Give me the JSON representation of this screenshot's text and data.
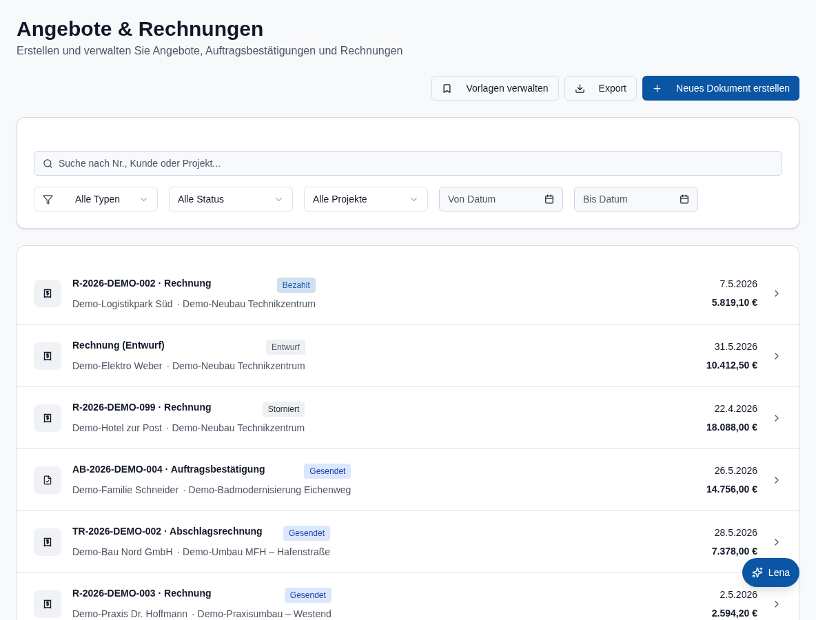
{
  "header": {
    "title": "Angebote & Rechnungen",
    "subtitle": "Erstellen und verwalten Sie Angebote, Auftragsbestätigungen und Rechnungen"
  },
  "actions": [
    {
      "kind": "templates",
      "label": "Vorlagen verwalten"
    },
    {
      "kind": "export",
      "label": "Export"
    },
    {
      "kind": "create",
      "label": "Neues Dokument erstellen"
    }
  ],
  "search": {
    "placeholder": "Suche nach Nr., Kunde oder Projekt..."
  },
  "filters": [
    {
      "kind": "select",
      "label": "Alle Typen"
    },
    {
      "kind": "select",
      "label": "Alle Status"
    },
    {
      "kind": "select",
      "label": "Alle Projekte"
    },
    {
      "kind": "date",
      "placeholder": "Von Datum"
    },
    {
      "kind": "date",
      "placeholder": "Bis Datum"
    }
  ],
  "documents": [
    {
      "kind": "invoice",
      "title": "R-2026-DEMO-002 · Rechnung",
      "color": "#cfe0f1",
      "badge": "Bezahlt",
      "customer": "Demo-Logistikpark Süd",
      "project": "· Demo-Neubau Technikzentrum",
      "date": "7.5.2026",
      "amount": "5.819,10 €"
    },
    {
      "kind": "invoice",
      "title": "Rechnung (Entwurf)",
      "color": "#eef0f3",
      "badge": "Entwurf",
      "customer": "Demo-Elektro Weber",
      "project": "· Demo-Neubau Technikzentrum",
      "date": "31.5.2026",
      "amount": "10.412,50 €"
    },
    {
      "kind": "invoice",
      "title": "R-2026-DEMO-099 · Rechnung",
      "color": "#eef0f2",
      "badge": "Storniert",
      "customer": "Demo-Hotel zur Post",
      "project": "· Demo-Neubau Technikzentrum",
      "date": "22.4.2026",
      "amount": "18.088,00 €"
    },
    {
      "kind": "confirmation",
      "title": "AB-2026-DEMO-004 · Auftragsbestätigung",
      "color": "#dbe7fd",
      "badge": "Gesendet",
      "customer": "Demo-Familie Schneider",
      "project": "· Demo-Badmodernisierung Eichenweg",
      "date": "26.5.2026",
      "amount": "14.756,00 €"
    },
    {
      "kind": "invoice",
      "title": "TR-2026-DEMO-002 · Abschlagsrechnung",
      "color": "#dbe7fd",
      "badge": "Gesendet",
      "customer": "Demo-Bau Nord GmbH",
      "project": "· Demo-Umbau MFH – Hafenstraße",
      "date": "28.5.2026",
      "amount": "7.378,00 €"
    },
    {
      "kind": "invoice",
      "title": "R-2026-DEMO-003 · Rechnung",
      "color": "#dbe7fd",
      "badge": "Gesendet",
      "customer": "Demo-Praxis Dr. Hoffmann",
      "project": "· Demo-Praxisumbau – Westend",
      "date": "2.5.2026",
      "amount": "2.594,20 €"
    }
  ],
  "assistant": {
    "label": "Lena"
  }
}
